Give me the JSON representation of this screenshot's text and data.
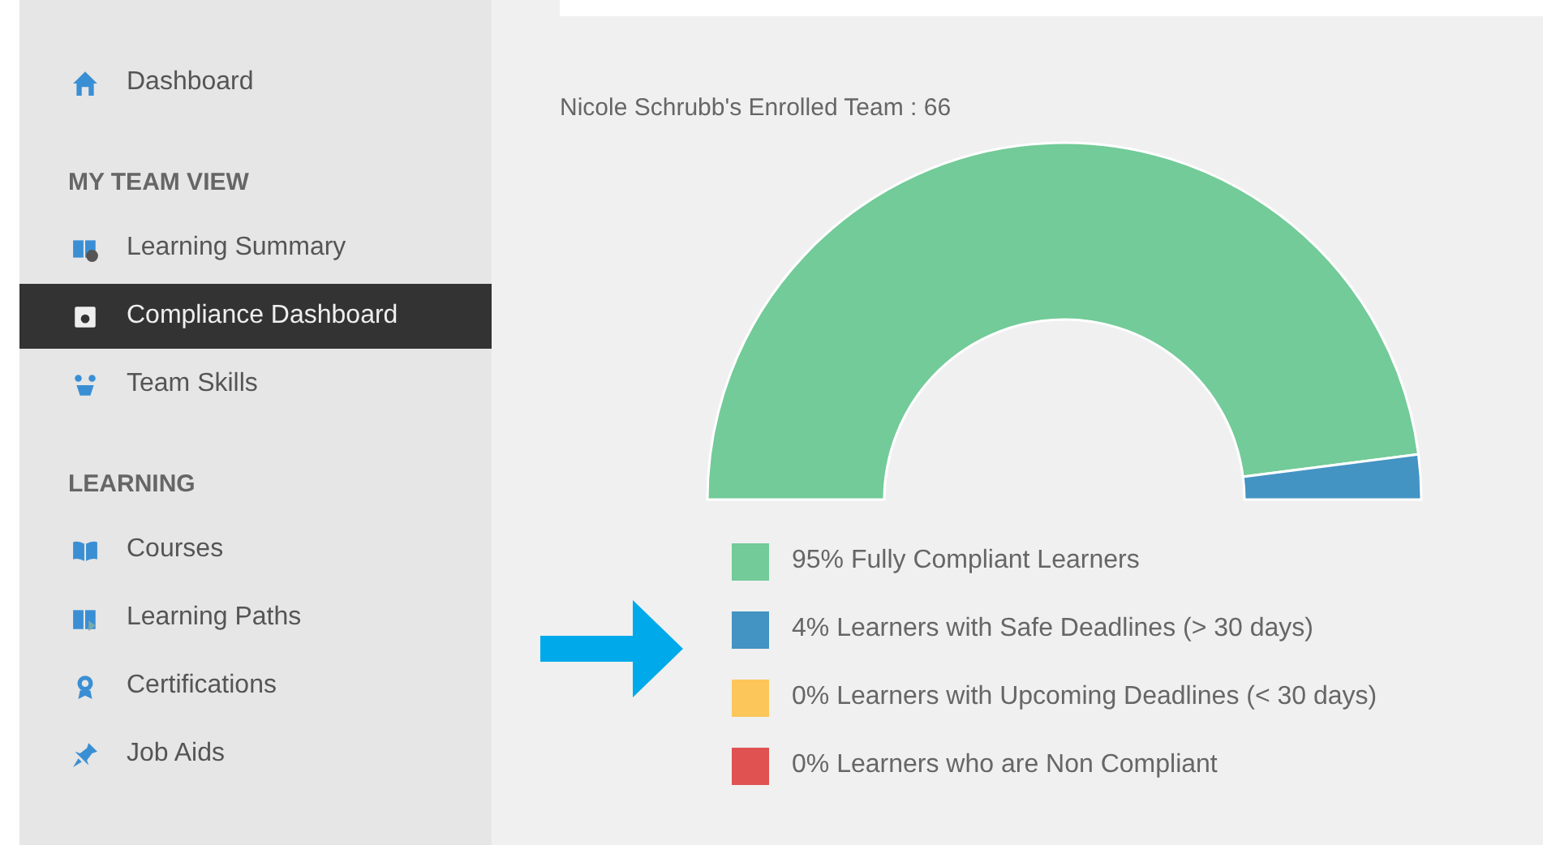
{
  "sidebar": {
    "items": [
      {
        "kind": "link",
        "label": "Dashboard",
        "selected": false
      },
      {
        "kind": "header",
        "label": "MY TEAM VIEW"
      },
      {
        "kind": "link",
        "label": "Learning Summary",
        "selected": false
      },
      {
        "kind": "link",
        "label": "Compliance Dashboard",
        "selected": true
      },
      {
        "kind": "link",
        "label": "Team Skills",
        "selected": false
      },
      {
        "kind": "header",
        "label": "LEARNING"
      },
      {
        "kind": "link",
        "label": "Courses",
        "selected": false
      },
      {
        "kind": "link",
        "label": "Learning Paths",
        "selected": false
      },
      {
        "kind": "link",
        "label": "Certifications",
        "selected": false
      },
      {
        "kind": "link",
        "label": "Job Aids",
        "selected": false
      }
    ]
  },
  "main": {
    "title": "Nicole Schrubb's Enrolled Team : 66",
    "chart_data": {
      "type": "donut",
      "categories": [
        "95% Fully Compliant Learners",
        "4% Learners with Safe Deadlines (> 30 days)",
        "0% Learners with Upcoming Deadlines (< 30 days)",
        "0% Learners who are Non Compliant"
      ],
      "values": [
        95,
        4,
        0,
        0
      ],
      "colors": [
        "#72cb98",
        "#4393c3",
        "#fdc65b",
        "#e05252"
      ],
      "legend": "bottom"
    }
  }
}
